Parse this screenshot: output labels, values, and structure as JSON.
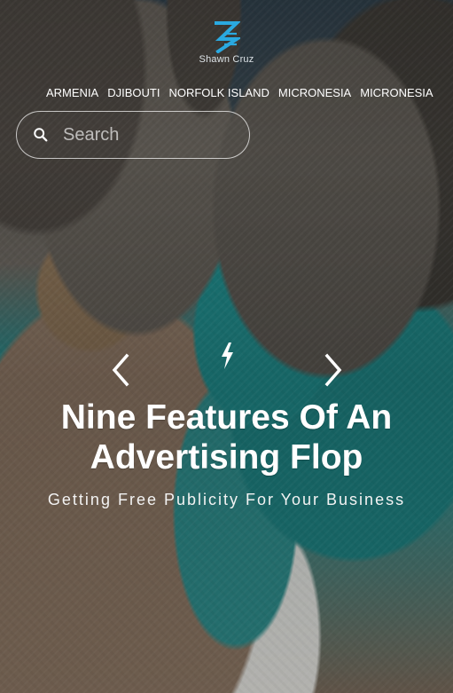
{
  "brand": {
    "name": "Shawn Cruz",
    "logo_color": "#2aa9e0"
  },
  "navigation": {
    "items": [
      "ARMENIA",
      "DJIBOUTI",
      "NORFOLK ISLAND",
      "MICRONESIA",
      "MICRONESIA"
    ]
  },
  "search": {
    "placeholder": "Search"
  },
  "hero": {
    "title": "Nine Features Of An Advertising Flop",
    "subtitle": "Getting Free Publicity For Your Business"
  },
  "icons": {
    "search": "search-icon",
    "bolt": "lightning-icon",
    "prev": "chevron-left-icon",
    "next": "chevron-right-icon"
  }
}
